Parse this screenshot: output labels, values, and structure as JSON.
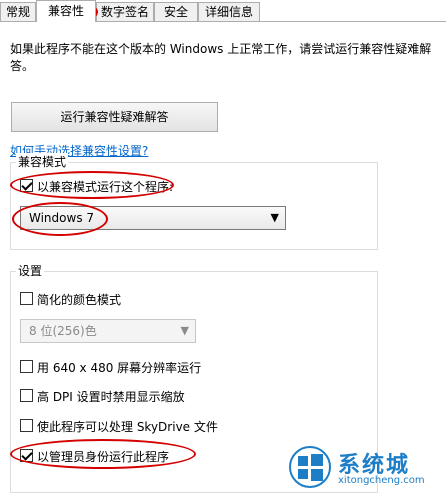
{
  "tabs": [
    {
      "label": "常规"
    },
    {
      "label": "兼容性"
    },
    {
      "label": "数字签名"
    },
    {
      "label": "安全"
    },
    {
      "label": "详细信息"
    }
  ],
  "intro_text": "如果此程序不能在这个版本的 Windows 上正常工作，请尝试运行兼容性疑难解答。",
  "troubleshoot_button": "运行兼容性疑难解答",
  "manual_link": "如何手动选择兼容性设置?",
  "compat_mode": {
    "group_title": "兼容模式",
    "checkbox_label": "以兼容模式运行这个程序:",
    "checked": true,
    "selected_os": "Windows 7"
  },
  "settings": {
    "group_title": "设置",
    "reduced_color": {
      "label": "简化的颜色模式",
      "checked": false
    },
    "color_select": "8 位(256)色",
    "resolution": {
      "label": "用 640 x 480 屏幕分辨率运行",
      "checked": false
    },
    "dpi": {
      "label": "高 DPI 设置时禁用显示缩放",
      "checked": false
    },
    "skydrive": {
      "label": "使此程序可以处理 SkyDrive 文件",
      "checked": false
    },
    "run_as_admin": {
      "label": "以管理员身份运行此程序",
      "checked": true
    }
  },
  "watermark": {
    "title": "系统城",
    "subtitle": "xitongcheng.com"
  },
  "colors": {
    "annotation": "#d40000",
    "link": "#0066cc",
    "brand": "#1d7ec7"
  }
}
